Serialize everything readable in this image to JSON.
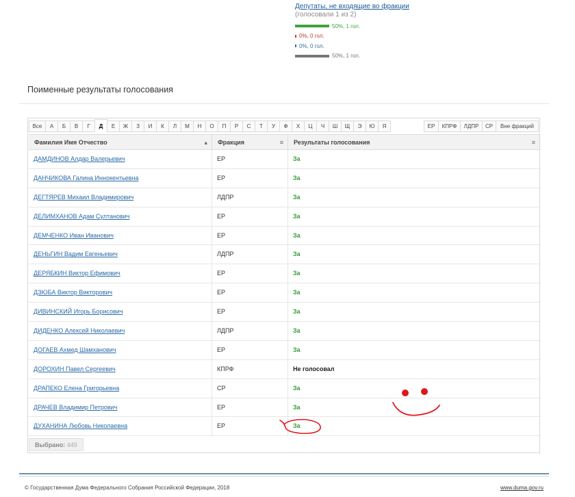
{
  "summary": {
    "title": "Депутаты, не входящие во фракции",
    "subtitle": "(голосовали 1 из 2)",
    "stats": [
      {
        "label": "50%, 1 гол.",
        "percent": 50,
        "color": "#3fa23f",
        "kind": "for"
      },
      {
        "label": "0%, 0 гол.",
        "percent": 0,
        "color": "#c0392b",
        "kind": "against"
      },
      {
        "label": "0%, 0 гол.",
        "percent": 0,
        "color": "#2f6fa0",
        "kind": "abstained"
      },
      {
        "label": "50%, 1 гол.",
        "percent": 50,
        "color": "#777777",
        "kind": "not-voted"
      }
    ]
  },
  "section_title": "Поименные результаты голосования",
  "letters": [
    "Все",
    "А",
    "Б",
    "В",
    "Г",
    "Д",
    "Е",
    "Ж",
    "З",
    "И",
    "К",
    "Л",
    "М",
    "Н",
    "О",
    "П",
    "Р",
    "С",
    "Т",
    "У",
    "Ф",
    "Х",
    "Ц",
    "Ч",
    "Ш",
    "Щ",
    "Э",
    "Ю",
    "Я"
  ],
  "active_letter": "Д",
  "factions": [
    "ЕР",
    "КПРФ",
    "ЛДПР",
    "СР",
    "Вне фракций"
  ],
  "table": {
    "headers": {
      "name": "Фамилия Имя Отчество",
      "faction": "Фракция",
      "result": "Результаты голосования"
    },
    "header_controls": {
      "name": "▴",
      "faction": "≡",
      "result": "≡"
    },
    "rows": [
      {
        "name": "ДАМДИНОВ Алдар Валерьевич",
        "faction": "ЕР",
        "result": "За"
      },
      {
        "name": "ДАНЧИКОВА Галина Иннокентьевна",
        "faction": "ЕР",
        "result": "За"
      },
      {
        "name": "ДЕГТЯРЕВ Михаил Владимирович",
        "faction": "ЛДПР",
        "result": "За"
      },
      {
        "name": "ДЕЛИМХАНОВ Адам Султанович",
        "faction": "ЕР",
        "result": "За"
      },
      {
        "name": "ДЕМЧЕНКО Иван Иванович",
        "faction": "ЕР",
        "result": "За"
      },
      {
        "name": "ДЕНЬГИН Вадим Евгеньевич",
        "faction": "ЛДПР",
        "result": "За"
      },
      {
        "name": "ДЕРЯБКИН Виктор Ефимович",
        "faction": "ЕР",
        "result": "За"
      },
      {
        "name": "ДЗЮБА Виктор Викторович",
        "faction": "ЕР",
        "result": "За"
      },
      {
        "name": "ДИВИНСКИЙ Игорь Борисович",
        "faction": "ЕР",
        "result": "За"
      },
      {
        "name": "ДИДЕНКО Алексей Николаевич",
        "faction": "ЛДПР",
        "result": "За"
      },
      {
        "name": "ДОГАЕВ Ахмед Шамханович",
        "faction": "ЕР",
        "result": "За"
      },
      {
        "name": "ДОРОХИН Павел Сергеевич",
        "faction": "КПРФ",
        "result": "Не голосовал"
      },
      {
        "name": "ДРАПЕКО Елена Григорьевна",
        "faction": "СР",
        "result": "За"
      },
      {
        "name": "ДРАЧЕВ Владимир Петрович",
        "faction": "ЕР",
        "result": "За"
      },
      {
        "name": "ДУХАНИНА Любовь Николаевна",
        "faction": "ЕР",
        "result": "За"
      }
    ]
  },
  "selected": {
    "label": "Выбрано:",
    "count": "449"
  },
  "footer": {
    "copyright": "© Государственная Дума Федерального Собрания Российской Федерации, 2018",
    "site": "www.duma.gov.ru"
  },
  "annotation_color": "#e0161b"
}
